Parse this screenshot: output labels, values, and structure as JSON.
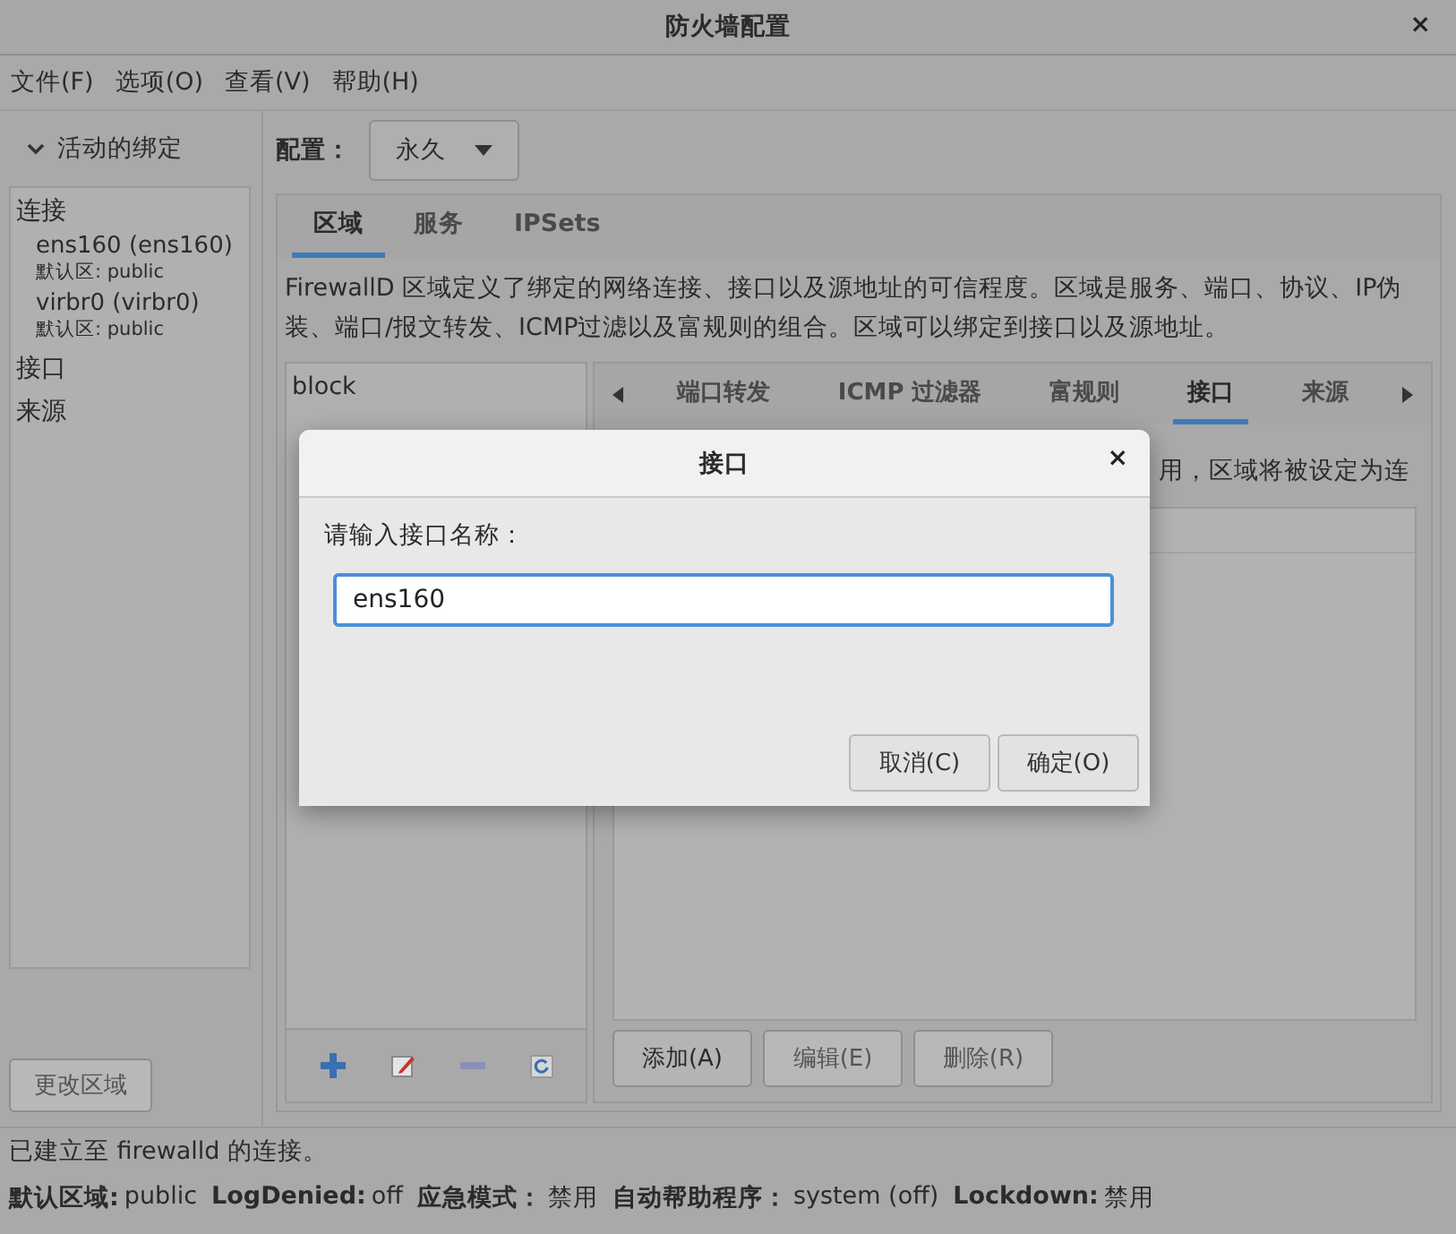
{
  "window": {
    "title": "防火墙配置",
    "close": "×"
  },
  "menu": [
    "文件(F)",
    "选项(O)",
    "查看(V)",
    "帮助(H)"
  ],
  "sidebar": {
    "header": "活动的绑定",
    "expanded": true,
    "groups": [
      {
        "label": "连接",
        "items": [
          {
            "name": "ens160 (ens160)",
            "zone": "默认区: public"
          },
          {
            "name": "virbr0 (virbr0)",
            "zone": "默认区: public"
          }
        ]
      },
      {
        "label": "接口"
      },
      {
        "label": "来源"
      }
    ]
  },
  "change_zone_button": {
    "label": "更改区域",
    "disabled": true
  },
  "config": {
    "label": "配置：",
    "value": "永久"
  },
  "tabs": [
    {
      "label": "区域",
      "selected": true
    },
    {
      "label": "服务",
      "selected": false
    },
    {
      "label": "IPSets",
      "selected": false
    }
  ],
  "description": "FirewallD 区域定义了绑定的网络连接、接口以及源地址的可信程度。区域是服务、端口、协议、IP伪装、端口/报文转发、ICMP过滤以及富规则的组合。区域可以绑定到接口以及源地址。",
  "zones": [
    {
      "name": "block",
      "selected": false
    }
  ],
  "subtabs": [
    {
      "label": "端口转发",
      "selected": false
    },
    {
      "label": "ICMP 过滤器",
      "selected": false
    },
    {
      "label": "富规则",
      "selected": false
    },
    {
      "label": "接口",
      "selected": true
    },
    {
      "label": "来源",
      "selected": false
    }
  ],
  "interface_note": "用，区域将被设定为连",
  "actions": [
    {
      "label": "添加(A)",
      "disabled": false
    },
    {
      "label": "编辑(E)",
      "disabled": true
    },
    {
      "label": "删除(R)",
      "disabled": true
    }
  ],
  "status": {
    "message": "已建立至 firewalld 的连接。",
    "fields": [
      {
        "label": "默认区域:",
        "value": "public"
      },
      {
        "label": "LogDenied:",
        "value": "off"
      },
      {
        "label": "应急模式：",
        "value": "禁用"
      },
      {
        "label": "自动帮助程序：",
        "value": "system (off)"
      },
      {
        "label": "Lockdown:",
        "value": "禁用"
      }
    ]
  },
  "dialog": {
    "title": "接口",
    "close": "×",
    "prompt": "请输入接口名称：",
    "value": "ens160",
    "focused": true,
    "buttons": [
      {
        "label": "取消(C)"
      },
      {
        "label": "确定(O)"
      }
    ]
  }
}
